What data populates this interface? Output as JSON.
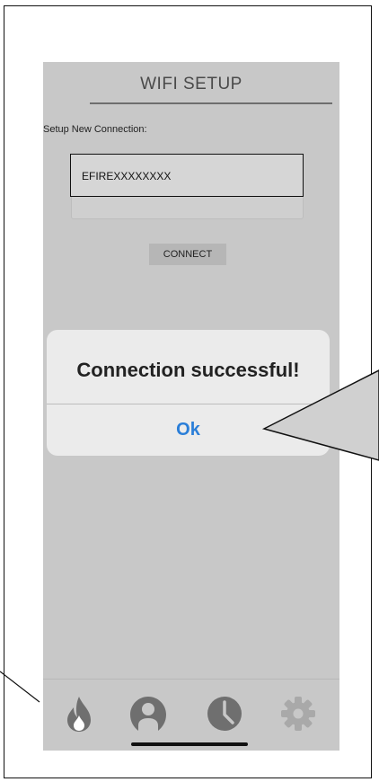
{
  "screen": {
    "title": "WIFI SETUP",
    "setup_label": "Setup New Connection:",
    "ssid_value": "EFIREXXXXXXXX",
    "password_value": "",
    "connect_label": "CONNECT"
  },
  "dialog": {
    "message": "Connection successful!",
    "ok_label": "Ok",
    "ok_color": "#2a7ed8"
  },
  "tabbar": {
    "items": [
      {
        "icon": "flame-icon"
      },
      {
        "icon": "user-icon"
      },
      {
        "icon": "clock-icon"
      },
      {
        "icon": "gear-icon"
      }
    ]
  }
}
